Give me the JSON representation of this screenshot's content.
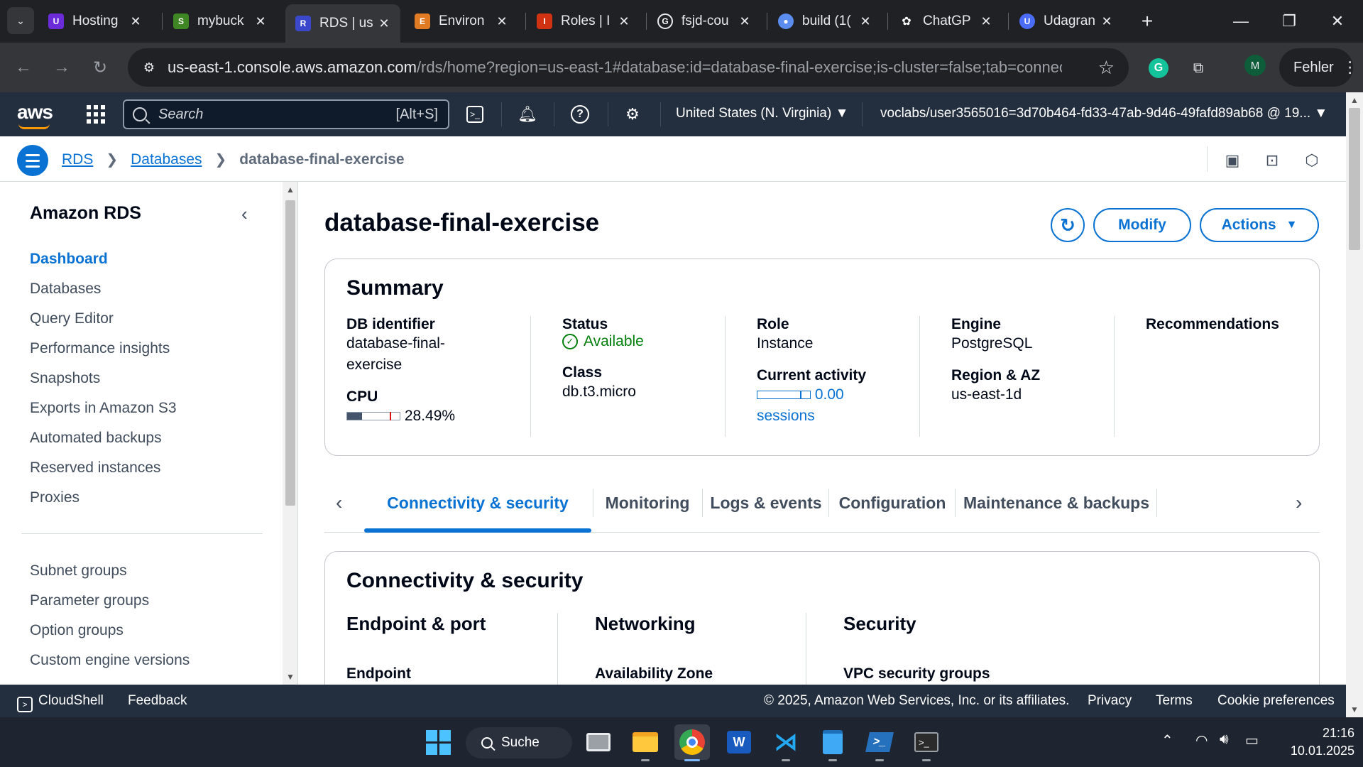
{
  "browser": {
    "tabs": [
      {
        "label": "Hosting",
        "active": false
      },
      {
        "label": "mybuck",
        "active": false
      },
      {
        "label": "RDS | us",
        "active": true
      },
      {
        "label": "Environ",
        "active": false
      },
      {
        "label": "Roles | I",
        "active": false
      },
      {
        "label": "fsjd-cou",
        "active": false
      },
      {
        "label": "build (1(",
        "active": false
      },
      {
        "label": "ChatGP",
        "active": false
      },
      {
        "label": "Udagran",
        "active": false
      }
    ],
    "url_host": "us-east-1.console.aws.amazon.com",
    "url_rest": "/rds/home?region=us-east-1#database:id=database-final-exercise;is-cluster=false;tab=connectivity",
    "profile_initial": "M",
    "error_button": "Fehler"
  },
  "aws_nav": {
    "logo": "aws",
    "search_placeholder": "Search",
    "search_shortcut": "[Alt+S]",
    "region": "United States (N. Virginia) ▼",
    "account": "voclabs/user3565016=3d70b464-fd33-47ab-9d46-49fafd89ab68 @ 19... ▼"
  },
  "breadcrumb": {
    "rds": "RDS",
    "databases": "Databases",
    "current": "database-final-exercise"
  },
  "sidebar": {
    "title": "Amazon RDS",
    "items": [
      "Dashboard",
      "Databases",
      "Query Editor",
      "Performance insights",
      "Snapshots",
      "Exports in Amazon S3",
      "Automated backups",
      "Reserved instances",
      "Proxies"
    ],
    "items2": [
      "Subnet groups",
      "Parameter groups",
      "Option groups",
      "Custom engine versions"
    ]
  },
  "page": {
    "title": "database-final-exercise",
    "modify_label": "Modify",
    "actions_label": "Actions"
  },
  "summary": {
    "title": "Summary",
    "db_identifier_label": "DB identifier",
    "db_identifier_line1": "database-final-",
    "db_identifier_line2": "exercise",
    "cpu_label": "CPU",
    "cpu_value": "28.49%",
    "cpu_fraction": 0.2849,
    "status_label": "Status",
    "status_value": "Available",
    "class_label": "Class",
    "class_value": "db.t3.micro",
    "role_label": "Role",
    "role_value": "Instance",
    "activity_label": "Current activity",
    "activity_value": "0.00",
    "activity_unit": "sessions",
    "engine_label": "Engine",
    "engine_value": "PostgreSQL",
    "region_label": "Region & AZ",
    "region_value": "us-east-1d",
    "recommendations_label": "Recommendations"
  },
  "tabs": [
    "Connectivity & security",
    "Monitoring",
    "Logs & events",
    "Configuration",
    "Maintenance & backups"
  ],
  "connectivity": {
    "title": "Connectivity & security",
    "endpoint_port": "Endpoint & port",
    "endpoint": "Endpoint",
    "networking": "Networking",
    "availability_zone": "Availability Zone",
    "security": "Security",
    "vpc_security_groups": "VPC security groups"
  },
  "footer": {
    "cloudshell": "CloudShell",
    "feedback": "Feedback",
    "copyright": "© 2025, Amazon Web Services, Inc. or its affiliates.",
    "privacy": "Privacy",
    "terms": "Terms",
    "cookies": "Cookie preferences"
  },
  "taskbar": {
    "search_label": "Suche",
    "time": "21:16",
    "date": "10.01.2025"
  },
  "colors": {
    "aws_nav": "#232f3e",
    "link_blue": "#0972d3",
    "available_green": "#037f0c",
    "aws_orange": "#ff9900"
  }
}
